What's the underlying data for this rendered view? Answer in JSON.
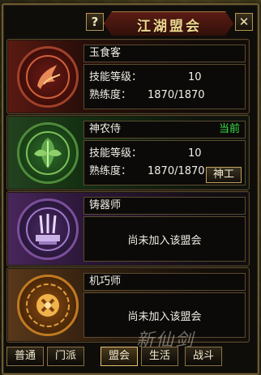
{
  "window": {
    "title": "江湖盟会",
    "help_label": "?",
    "close_label": "✕"
  },
  "guilds": [
    {
      "name": "玉食客",
      "skill_label": "技能等级：",
      "skill_value": "10",
      "prof_label": "熟练度：",
      "prof_value": "1870/1870",
      "status": "",
      "emblem": "phoenix-emblem-icon",
      "color": "#a0402a"
    },
    {
      "name": "神农侍",
      "skill_label": "技能等级：",
      "skill_value": "10",
      "prof_label": "熟练度：",
      "prof_value": "1870/1870",
      "status": "当前",
      "action_label": "神工",
      "emblem": "herb-emblem-icon",
      "color": "#4f8a3a"
    },
    {
      "name": "铸器师",
      "not_joined": "尚未加入该盟会",
      "emblem": "forge-emblem-icon",
      "color": "#7a4f9a"
    },
    {
      "name": "机巧师",
      "not_joined": "尚未加入该盟会",
      "emblem": "gear-emblem-icon",
      "color": "#c07a22"
    }
  ],
  "tabs": [
    "普通",
    "门派",
    "盟会",
    "生活",
    "战斗"
  ],
  "active_tab": "盟会",
  "watermark": "新仙剑"
}
